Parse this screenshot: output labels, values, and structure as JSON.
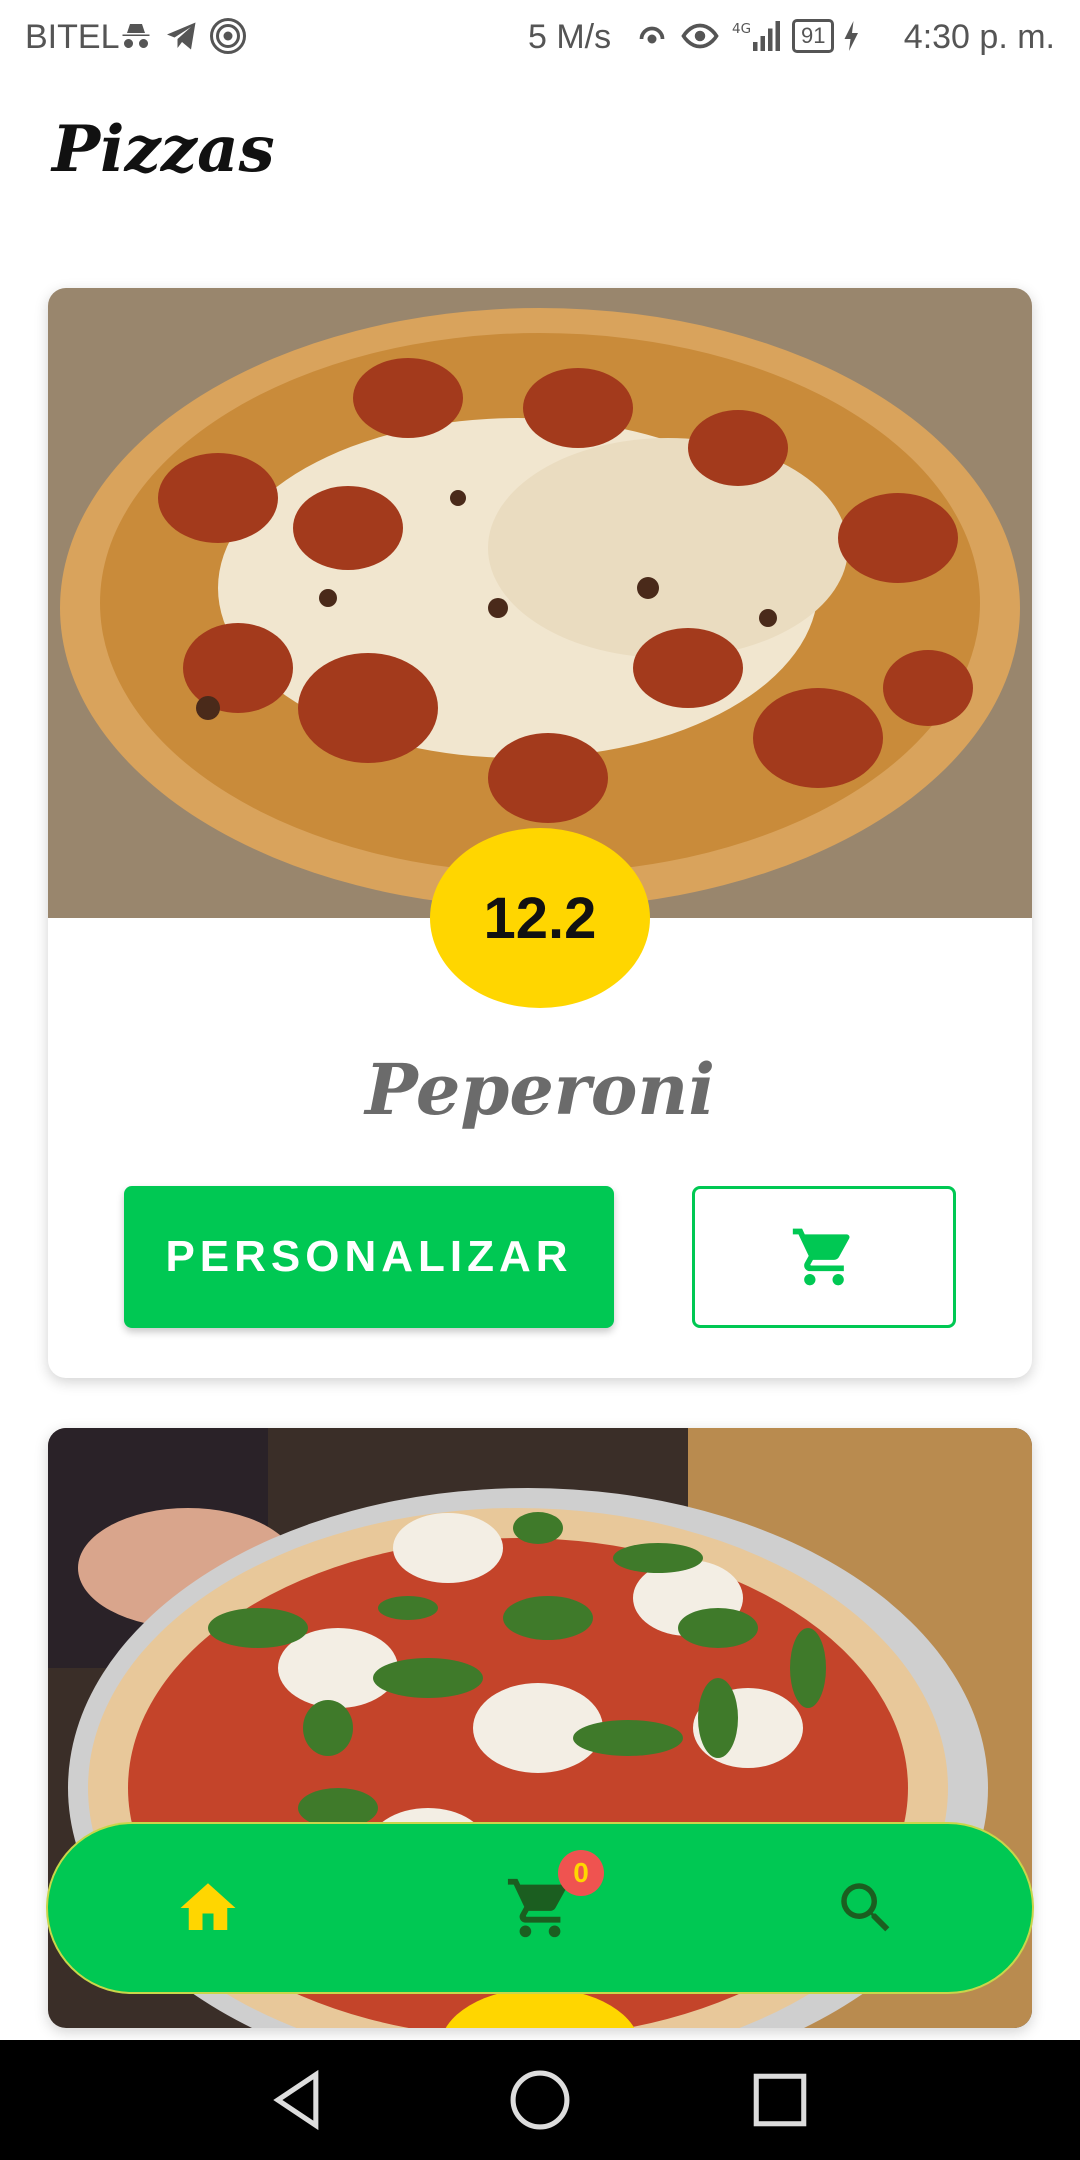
{
  "status_bar": {
    "carrier": "BITEL",
    "net_speed": "5 M/s",
    "battery": "91",
    "time": "4:30 p. m.",
    "icons": [
      "incognito-icon",
      "telegram-icon",
      "hotspot-icon",
      "wifi-calling-icon",
      "eye-icon",
      "signal-4g-icon",
      "battery-icon",
      "charging-icon"
    ]
  },
  "page": {
    "title": "Pizzas"
  },
  "pizzas": [
    {
      "name": "Peperoni",
      "price": "12.2",
      "customize_label": "PERSONALIZAR"
    },
    {
      "name": "",
      "price": ""
    }
  ],
  "bottom_nav": {
    "items": [
      "home-icon",
      "cart-icon",
      "search-icon"
    ],
    "cart_count": "0",
    "colors": {
      "background": "#00C853",
      "home_icon": "#FFD600",
      "other_icons": "#1B5E20"
    }
  },
  "theme": {
    "accent_green": "#00C853",
    "badge_yellow": "#FFD600"
  }
}
